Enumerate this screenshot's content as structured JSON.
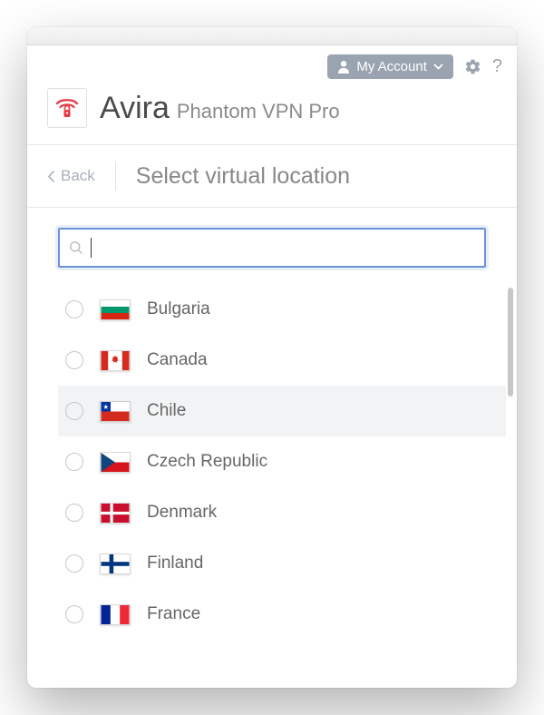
{
  "toolbar": {
    "account_label": "My Account"
  },
  "brand": {
    "name": "Avira",
    "sub": "Phantom VPN Pro"
  },
  "subheader": {
    "back_label": "Back",
    "title": "Select virtual location"
  },
  "search": {
    "value": "",
    "placeholder": ""
  },
  "locations": [
    {
      "name": "Bulgaria",
      "flag_svg": "bg",
      "hover": false
    },
    {
      "name": "Canada",
      "flag_svg": "ca",
      "hover": false
    },
    {
      "name": "Chile",
      "flag_svg": "cl",
      "hover": true
    },
    {
      "name": "Czech Republic",
      "flag_svg": "cz",
      "hover": false
    },
    {
      "name": "Denmark",
      "flag_svg": "dk",
      "hover": false
    },
    {
      "name": "Finland",
      "flag_svg": "fi",
      "hover": false
    },
    {
      "name": "France",
      "flag_svg": "fr",
      "hover": false
    }
  ]
}
